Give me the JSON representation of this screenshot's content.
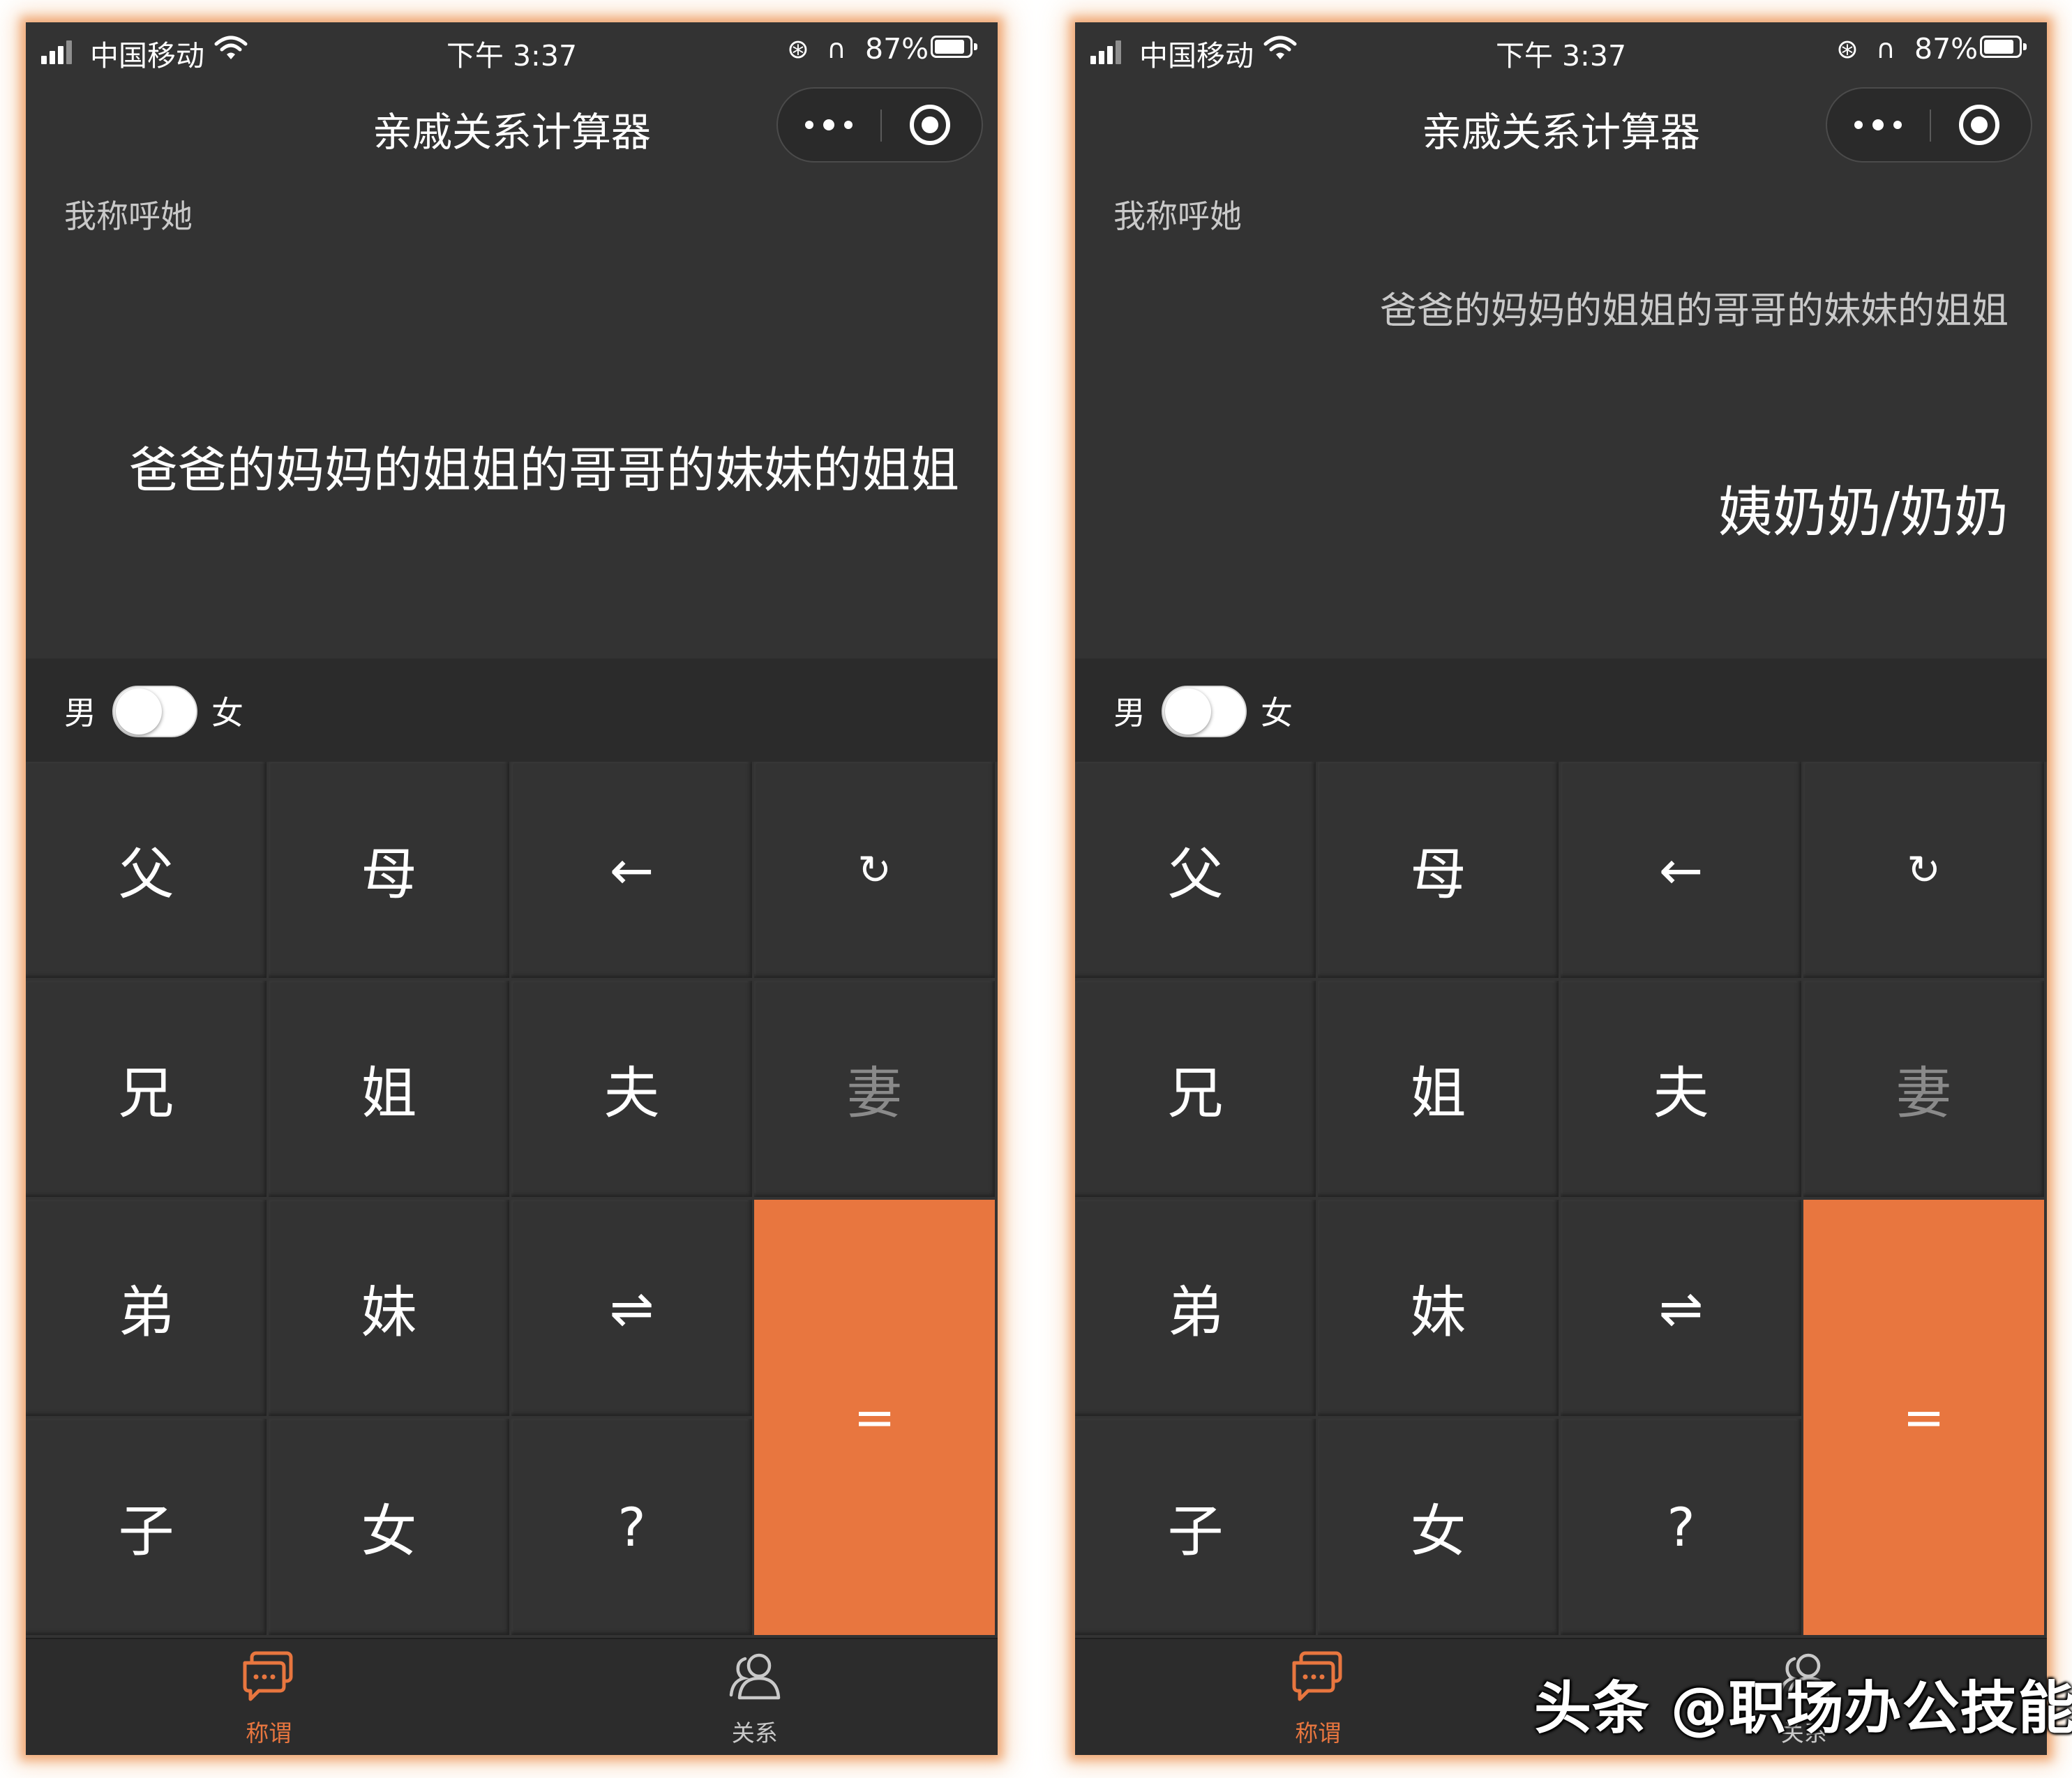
{
  "status_bar": {
    "carrier": "中国移动",
    "time": "下午 3:37",
    "battery": "87%"
  },
  "app": {
    "title": "亲戚关系计算器"
  },
  "display": {
    "call_label": "我称呼她",
    "expression": "爸爸的妈妈的姐姐的哥哥的妹妹的姐姐",
    "result": "姨奶奶/奶奶"
  },
  "gender": {
    "male": "男",
    "female": "女",
    "selected": "男"
  },
  "keys": {
    "father": "父",
    "mother": "母",
    "backspace": "←",
    "reset": "↻",
    "elder_brother": "兄",
    "elder_sister": "姐",
    "husband": "夫",
    "wife": "妻",
    "younger_brother": "弟",
    "younger_sister": "妹",
    "swap": "⇌",
    "equals": "=",
    "son": "子",
    "daughter": "女",
    "question": "?"
  },
  "tabs": {
    "appellation": "称谓",
    "relation": "关系"
  },
  "watermark": "头条 @职场办公技能",
  "colors": {
    "accent": "#e8763f",
    "background": "#333333",
    "glow": "#f0a070"
  }
}
